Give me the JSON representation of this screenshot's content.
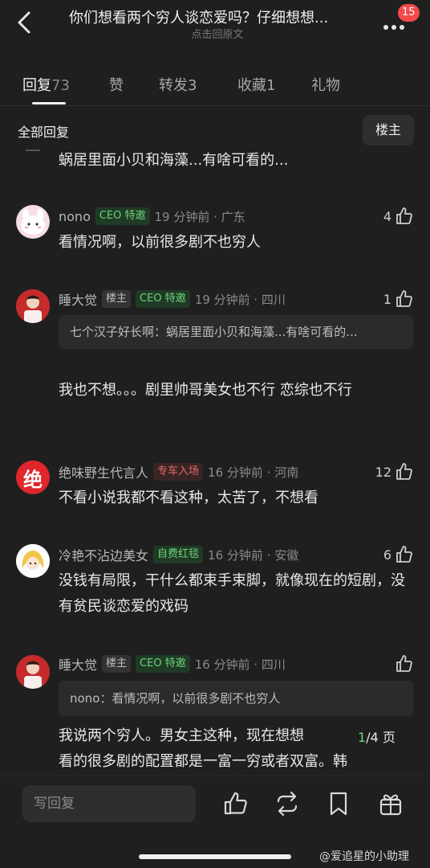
{
  "header": {
    "title": "你们想看两个穷人谈恋爱吗？仔细想想...",
    "subtitle": "点击回原文",
    "notification_count": "15"
  },
  "tabs": [
    {
      "label": "回复",
      "count": "73"
    },
    {
      "label": "赞",
      "count": ""
    },
    {
      "label": "转发",
      "count": "3"
    },
    {
      "label": "收藏",
      "count": "1"
    },
    {
      "label": "礼物",
      "count": ""
    }
  ],
  "section": {
    "all_replies": "全部回复",
    "owner_filter": "楼主"
  },
  "partial_comment_text": "蜗居里面小贝和海藻...有啥可看的...",
  "comments": [
    {
      "name": "nono",
      "tags": [
        "CEO 特邀"
      ],
      "time_location": "19 分钟前 · 广东",
      "likes": "4",
      "text": "看情况啊，以前很多剧不也穷人"
    },
    {
      "name": "睡大觉",
      "tags": [
        "楼主",
        "CEO 特邀"
      ],
      "time_location": "19 分钟前 · 四川",
      "likes": "1",
      "quote": "七个汉子好长啊：蜗居里面小贝和海藻...有啥可看的...",
      "text": "我也不想。。。剧里帅哥美女也不行 恋综也不行"
    },
    {
      "name": "绝味野生代言人",
      "tags": [
        "专车入场"
      ],
      "time_location": "16 分钟前 · 河南",
      "likes": "12",
      "text": "不看小说我都不看这种，太苦了，不想看"
    },
    {
      "name": "冷艳不沾边美女",
      "tags": [
        "自费红毯"
      ],
      "time_location": "16 分钟前 · 安徽",
      "likes": "6",
      "text": "没钱有局限，干什么都束手束脚，就像现在的短剧，没有贫民谈恋爱的戏码"
    },
    {
      "name": "睡大觉",
      "tags": [
        "楼主",
        "CEO 特邀"
      ],
      "time_location": "16 分钟前 · 四川",
      "likes": "",
      "quote": "nono：看情况啊，以前很多剧不也穷人",
      "text_line1": "我说两个穷人。男女主这种，现在想想",
      "text_line2": "看的很多剧的配置都是一富一穷或者双富。韩"
    }
  ],
  "pager": {
    "current": "1",
    "total": "/4 页"
  },
  "avatar_glyph": "绝",
  "bottom_bar": {
    "reply_placeholder": "写回复"
  },
  "watermark": "@爱追星的小助理",
  "colors": {
    "background": "#1f1f1f",
    "badge": "#f24a4a",
    "green_tag": "#6ed17a",
    "red_tag": "#e56a6a"
  }
}
